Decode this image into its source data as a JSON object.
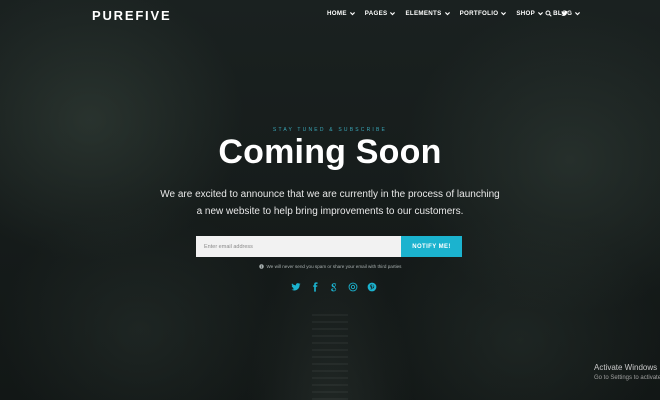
{
  "brand": {
    "name": "PUREFIVE"
  },
  "nav": {
    "items": [
      "HOME",
      "PAGES",
      "ELEMENTS",
      "PORTFOLIO",
      "SHOP",
      "BLOG"
    ]
  },
  "hero": {
    "eyebrow": "STAY TUNED & SUBSCRIBE",
    "title": "Coming Soon",
    "line1": "We are excited to announce that we are currently in the process of launching",
    "line2": "a new website to help bring improvements to our customers."
  },
  "form": {
    "placeholder": "Enter email address",
    "button": "NOTIFY ME!",
    "note": "We will never send you spam or share your email with third parties"
  },
  "social": [
    "twitter-icon",
    "facebook-icon",
    "google-plus-icon",
    "instagram-icon",
    "pinterest-icon"
  ],
  "os_watermark": {
    "title": "Activate Windows",
    "subtitle": "Go to Settings to activate"
  },
  "colors": {
    "accent": "#1bb3cf",
    "eyebrow": "#3aa7b8",
    "background": "#141a1a"
  }
}
